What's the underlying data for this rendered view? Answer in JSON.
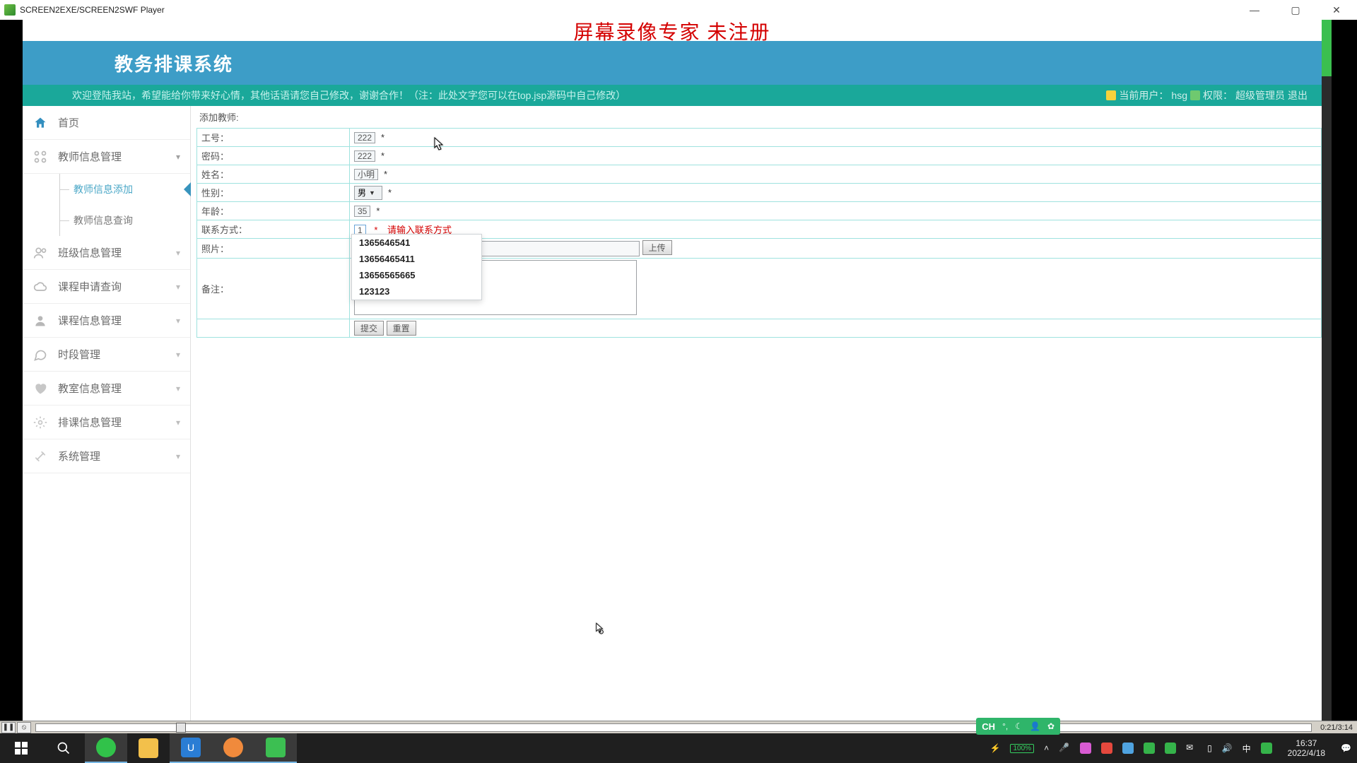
{
  "window": {
    "title": "SCREEN2EXE/SCREEN2SWF Player"
  },
  "watermark": "屏幕录像专家  未注册",
  "banner": {
    "title": "教务排课系统"
  },
  "subheader": {
    "welcome": "欢迎登陆我站，希望能给你带来好心情，其他话语请您自己修改，谢谢合作！（注：此处文字您可以在top.jsp源码中自己修改）",
    "user_label": "当前用户：",
    "user": "hsg",
    "role_label": "权限：",
    "role": "超级管理员",
    "logout": "退出"
  },
  "sidebar": {
    "home": "首页",
    "items": [
      {
        "label": "教师信息管理",
        "expanded": true,
        "children": [
          "教师信息添加",
          "教师信息查询"
        ],
        "active_child": 0
      },
      {
        "label": "班级信息管理"
      },
      {
        "label": "课程申请查询"
      },
      {
        "label": "课程信息管理"
      },
      {
        "label": "时段管理"
      },
      {
        "label": "教室信息管理"
      },
      {
        "label": "排课信息管理"
      },
      {
        "label": "系统管理"
      }
    ]
  },
  "form": {
    "title": "添加教师:",
    "labels": {
      "id": "工号：",
      "pwd": "密码：",
      "name": "姓名：",
      "gender": "性别：",
      "age": "年龄：",
      "contact": "联系方式：",
      "photo": "照片：",
      "remark": "备注："
    },
    "values": {
      "id": "222",
      "pwd": "222",
      "name": "小明",
      "gender": "男",
      "age": "35",
      "contact": "1"
    },
    "contact_hint": "请输入联系方式",
    "upload": "上传",
    "submit": "提交",
    "reset": "重置",
    "autocomplete": [
      "1365646541",
      "13656465411",
      "13656565665",
      "123123"
    ]
  },
  "ime": {
    "lang": "CH",
    "punct": "°,",
    "moon": "☾",
    "user": "👤",
    "gear": "✿"
  },
  "player": {
    "time": "0:21/3:14"
  },
  "taskbar": {
    "battery": "100%",
    "ime_lang": "中",
    "time": "16:37",
    "date": "2022/4/18"
  }
}
